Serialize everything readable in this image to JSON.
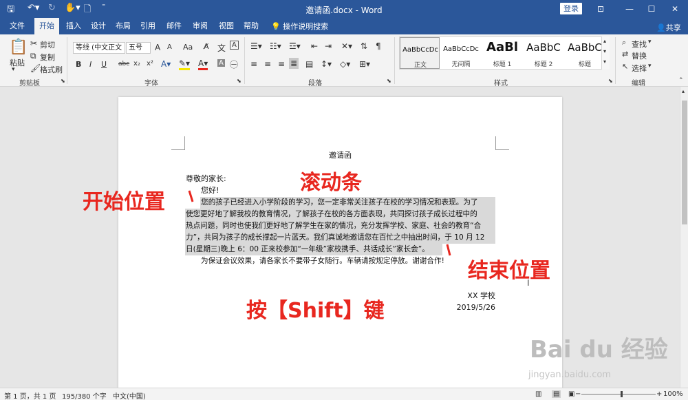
{
  "window": {
    "title": "邀请函.docx - Word",
    "login_label": "登录",
    "share_label": "共享"
  },
  "tabs": [
    "文件",
    "开始",
    "插入",
    "设计",
    "布局",
    "引用",
    "邮件",
    "审阅",
    "视图",
    "帮助"
  ],
  "active_tab": "开始",
  "tell_me": "操作说明搜索",
  "clipboard": {
    "paste": "粘贴",
    "cut": "剪切",
    "copy": "复制",
    "format_painter": "格式刷",
    "label": "剪贴板"
  },
  "font": {
    "family": "等线 (中文正文",
    "size": "五号",
    "label": "字体",
    "grow": "A",
    "shrink": "A",
    "case": "Aa",
    "bold": "B",
    "italic": "I",
    "underline": "U",
    "strike": "abc",
    "sub": "x₂",
    "sup": "x²"
  },
  "paragraph": {
    "label": "段落"
  },
  "styles": {
    "label": "样式",
    "items": [
      {
        "sample": "AaBbCcDc",
        "name": "正文",
        "selected": true
      },
      {
        "sample": "AaBbCcDc",
        "name": "无间隔",
        "selected": false
      },
      {
        "sample": "AaBl",
        "name": "标题 1",
        "selected": false
      },
      {
        "sample": "AaBbC",
        "name": "标题 2",
        "selected": false
      },
      {
        "sample": "AaBbC",
        "name": "标题",
        "selected": false
      }
    ]
  },
  "editing": {
    "find": "查找",
    "replace": "替换",
    "select": "选择",
    "label": "编辑"
  },
  "document": {
    "title": "邀请函",
    "salutation": "尊敬的家长:",
    "greeting": "您好!",
    "selected_lines": [
      "您的孩子已经进入小学阶段的学习，您一定非常关注孩子在校的学习情况和表现。为了",
      "使您更好地了解我校的教育情况，了解孩子在校的各方面表现，共同探讨孩子成长过程中的",
      "热点问题，同时也使我们更好地了解学生在家的情况，充分发挥学校、家庭、社会的教育“合",
      "力”，共同为孩子的成长撑起一片蓝天。我们真诚地邀请您在百忙之中抽出时间，于 10 月 12",
      "日(星期三)晚上 6：00 正来校参加“一年级”家校携手、共话成长”家长会”。"
    ],
    "note": "为保证会议效果，请各家长不要带子女随行。车辆请按规定停放。谢谢合作!",
    "signature": "XX 学校",
    "date": "2019/5/26"
  },
  "annotations": {
    "start": "开始位置",
    "scrollbar": "滚动条",
    "end": "结束位置",
    "shift_key": "按【Shift】键"
  },
  "status": {
    "page": "第 1 页，共 1 页",
    "words": "195/380 个字",
    "language": "中文(中国)",
    "zoom": "100%"
  },
  "watermark": {
    "brand": "Bai du 经验",
    "url": "jingyan.baidu.com"
  },
  "colors": {
    "brand": "#2b579a",
    "annotation": "#e8271f",
    "selection": "#d9d9d9"
  }
}
